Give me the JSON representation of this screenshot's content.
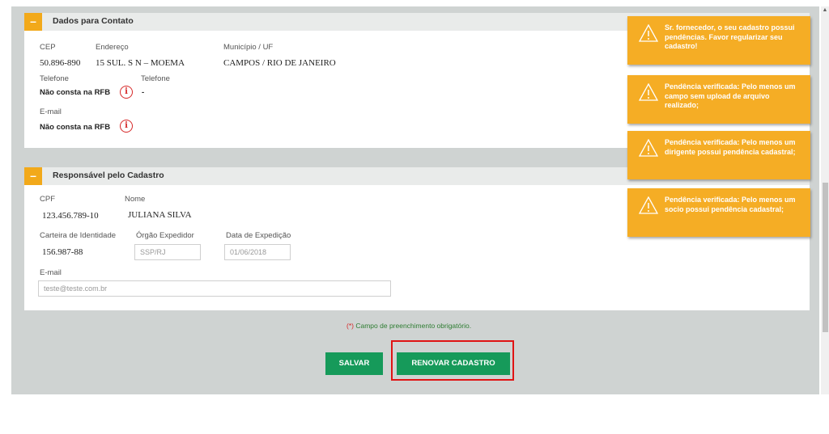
{
  "contato": {
    "title": "Dados para Contato",
    "toggle": "–",
    "cep_label": "CEP",
    "cep": "50.896-890",
    "endereco_label": "Endereço",
    "endereco": "15 SUL. S N – MOEMA",
    "municipio_label": "Município / UF",
    "municipio": "CAMPOS / RIO DE JANEIRO",
    "telefone1_label": "Telefone",
    "telefone1": "Não consta na RFB",
    "telefone2_label": "Telefone",
    "telefone2": "-",
    "email_label": "E-mail",
    "email": "Não consta na RFB",
    "info_icon": "i"
  },
  "responsavel": {
    "title": "Responsável pelo Cadastro",
    "toggle": "–",
    "cpf_label": "CPF",
    "cpf": "123.456.789-10",
    "nome_label": "Nome",
    "nome": "JULIANA SILVA",
    "identidade_label": "Carteira de Identidade",
    "identidade": "156.987-88",
    "orgao_label": "Órgão Expedidor",
    "orgao_value": "SSP/RJ",
    "data_label": "Data de Expedição",
    "data_value": "01/06/2018",
    "email_label": "E-mail",
    "email_value": "teste@teste.com.br"
  },
  "footnote": {
    "star": "(*)",
    "text": "Campo de preenchimento obrigatório."
  },
  "buttons": {
    "salvar": "SALVAR",
    "renovar": "RENOVAR CADASTRO"
  },
  "toasts": [
    {
      "text": "Sr. fornecedor, o seu cadastro possui pendências. Favor regularizar seu cadastro!",
      "icon": "warning-triangle"
    },
    {
      "text": "Pendência verificada: Pelo menos um campo sem upload de arquivo realizado;",
      "icon": "warning-triangle"
    },
    {
      "text": "Pendência verificada: Pelo menos um dirigente possui pendência cadastral;",
      "icon": "warning-triangle"
    },
    {
      "text": "Pendência verificada: Pelo menos um socio possui pendência cadastral;",
      "icon": "warning-triangle"
    }
  ],
  "colors": {
    "accent_orange": "#f2a91a",
    "toast_bg": "#f5ad25",
    "button_green": "#169a5a",
    "highlight_red": "#e01414"
  }
}
